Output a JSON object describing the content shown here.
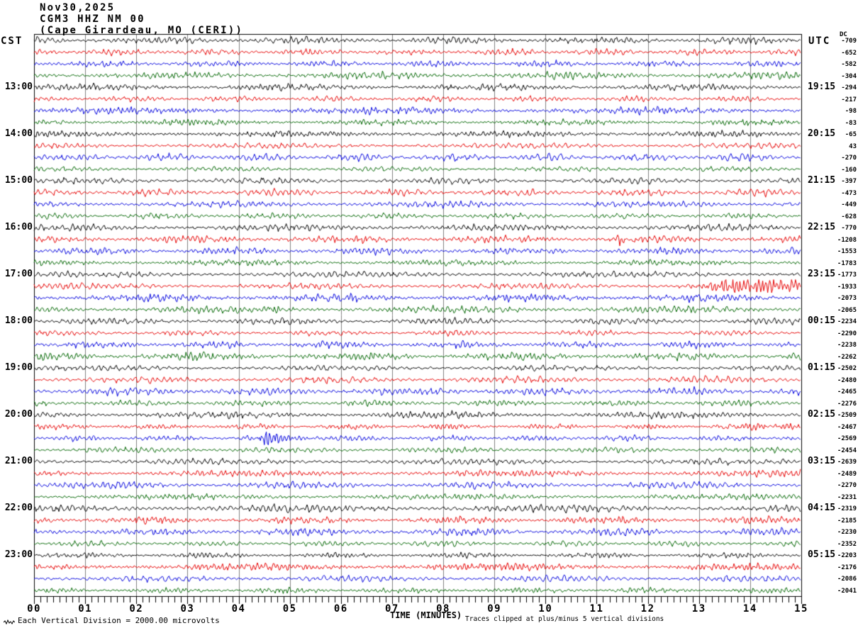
{
  "header": {
    "date": "Nov30,2025",
    "station": "CGM3 HHZ NM 00",
    "location": "(Cape Girardeau, MO (CERI))"
  },
  "axes": {
    "left_tz": "CST",
    "right_tz": "UTC",
    "dc_header": "DC",
    "x_title": "TIME (MINUTES)"
  },
  "footer": {
    "scale_note": "Each Vertical Division = 2000.00 microvolts",
    "clip_note": "Traces clipped at plus/minus 5 vertical divisions"
  },
  "chart_data": {
    "type": "line",
    "subtype": "helicorder-seismogram",
    "x_axis": {
      "label": "TIME (MINUTES)",
      "range_minutes": [
        0,
        15
      ],
      "tick_labels": [
        "00",
        "01",
        "02",
        "03",
        "04",
        "05",
        "06",
        "07",
        "08",
        "09",
        "10",
        "11",
        "12",
        "13",
        "14",
        "15"
      ],
      "minor_ticks_per_minute": 8
    },
    "row_duration_minutes": 15,
    "grid": {
      "vertical_minute_lines": true,
      "gridline_color": "#808080",
      "border_color": "#000000"
    },
    "colors": {
      "black": "#000000",
      "red": "#e60000",
      "blue": "#0000dd",
      "green": "#006600"
    },
    "trace_color_cycle": [
      "black",
      "red",
      "blue",
      "green"
    ],
    "left_hour_labels": [
      "13:00",
      "14:00",
      "15:00",
      "16:00",
      "17:00",
      "18:00",
      "19:00",
      "20:00",
      "21:00",
      "22:00",
      "23:00"
    ],
    "right_hour_labels": [
      "19:15",
      "20:15",
      "21:15",
      "22:15",
      "23:15",
      "00:15",
      "01:15",
      "02:15",
      "03:15",
      "04:15",
      "05:15"
    ],
    "first_hour_label_row": 4,
    "hour_label_row_step": 4,
    "rows": [
      {
        "color": "black",
        "dc": -709
      },
      {
        "color": "red",
        "dc": -652
      },
      {
        "color": "blue",
        "dc": -582
      },
      {
        "color": "green",
        "dc": -304
      },
      {
        "color": "black",
        "dc": -294
      },
      {
        "color": "red",
        "dc": -217
      },
      {
        "color": "blue",
        "dc": -98
      },
      {
        "color": "green",
        "dc": -83
      },
      {
        "color": "black",
        "dc": -65
      },
      {
        "color": "red",
        "dc": 43
      },
      {
        "color": "blue",
        "dc": -270
      },
      {
        "color": "green",
        "dc": -160
      },
      {
        "color": "black",
        "dc": -397
      },
      {
        "color": "red",
        "dc": -473
      },
      {
        "color": "blue",
        "dc": -449
      },
      {
        "color": "green",
        "dc": -628
      },
      {
        "color": "black",
        "dc": -770
      },
      {
        "color": "red",
        "dc": -1208
      },
      {
        "color": "blue",
        "dc": -1553
      },
      {
        "color": "green",
        "dc": -1783
      },
      {
        "color": "black",
        "dc": -1773
      },
      {
        "color": "red",
        "dc": -1933
      },
      {
        "color": "blue",
        "dc": -2073
      },
      {
        "color": "green",
        "dc": -2065
      },
      {
        "color": "black",
        "dc": -2234
      },
      {
        "color": "red",
        "dc": -2290
      },
      {
        "color": "blue",
        "dc": -2238
      },
      {
        "color": "green",
        "dc": -2262
      },
      {
        "color": "black",
        "dc": -2502
      },
      {
        "color": "red",
        "dc": -2480
      },
      {
        "color": "blue",
        "dc": -2465
      },
      {
        "color": "green",
        "dc": -2276
      },
      {
        "color": "black",
        "dc": -2509
      },
      {
        "color": "red",
        "dc": -2467
      },
      {
        "color": "blue",
        "dc": -2569
      },
      {
        "color": "green",
        "dc": -2454
      },
      {
        "color": "black",
        "dc": -2639
      },
      {
        "color": "red",
        "dc": -2489
      },
      {
        "color": "blue",
        "dc": -2270
      },
      {
        "color": "green",
        "dc": -2231
      },
      {
        "color": "black",
        "dc": -2319
      },
      {
        "color": "red",
        "dc": -2185
      },
      {
        "color": "blue",
        "dc": -2230
      },
      {
        "color": "green",
        "dc": -2352
      },
      {
        "color": "black",
        "dc": -2203
      },
      {
        "color": "red",
        "dc": -2176
      },
      {
        "color": "blue",
        "dc": -2086
      },
      {
        "color": "green",
        "dc": -2041
      }
    ],
    "events": [
      {
        "row": 17,
        "peak_min": 9.9,
        "rise": 0.05,
        "decay": 0.07,
        "amp": 5.0
      },
      {
        "row": 17,
        "peak_min": 11.45,
        "rise": 0.06,
        "decay": 0.1,
        "amp": 6.5
      },
      {
        "row": 21,
        "peak_min": 13.55,
        "rise": 0.3,
        "decay": 9.0,
        "amp": 7.2
      },
      {
        "row": 23,
        "peak_min": 4.62,
        "rise": 0.1,
        "decay": 0.16,
        "amp": 5.0
      },
      {
        "row": 33,
        "peak_min": 14.7,
        "rise": 0.45,
        "decay": 4.0,
        "amp": 3.0
      },
      {
        "row": 34,
        "peak_min": 4.6,
        "rise": 0.13,
        "decay": 0.45,
        "amp": 8.2
      }
    ]
  }
}
